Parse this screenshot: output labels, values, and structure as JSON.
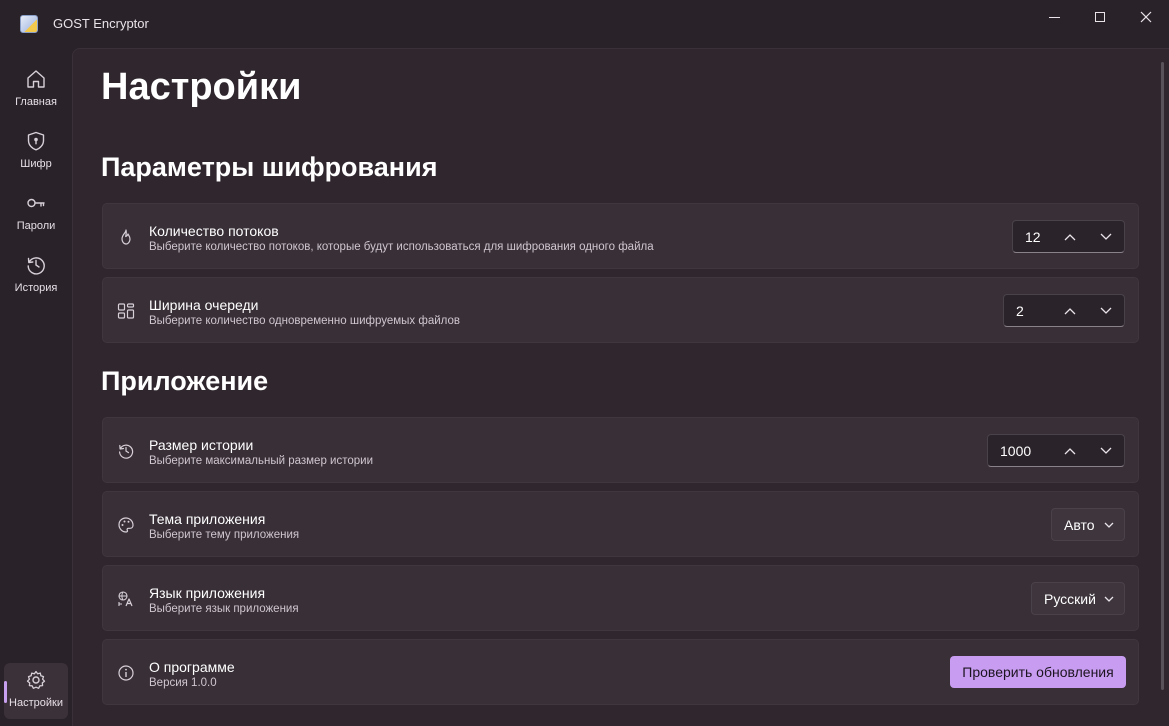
{
  "window": {
    "title": "GOST Encryptor",
    "controls": {
      "minimize": "minimize-icon",
      "maximize": "maximize-icon",
      "close": "close-icon"
    }
  },
  "nav": {
    "items": [
      {
        "label": "Главная",
        "icon": "home-icon"
      },
      {
        "label": "Шифр",
        "icon": "shield-icon"
      },
      {
        "label": "Пароли",
        "icon": "key-icon"
      },
      {
        "label": "История",
        "icon": "history-icon"
      }
    ],
    "settings": {
      "label": "Настройки",
      "icon": "gear-icon",
      "active": true
    }
  },
  "page": {
    "title": "Настройки"
  },
  "sections": {
    "encryption": {
      "title": "Параметры шифрования",
      "threads": {
        "title": "Количество потоков",
        "subtitle": "Выберите количество потоков, которые будут использоваться для шифрования одного файла",
        "value": "12",
        "icon": "flame-icon"
      },
      "queue": {
        "title": "Ширина очереди",
        "subtitle": "Выберите количество одновременно шифруемых файлов",
        "value": "2",
        "icon": "grid-icon"
      }
    },
    "app": {
      "title": "Приложение",
      "history": {
        "title": "Размер истории",
        "subtitle": "Выберите максимальный размер истории",
        "value": "1000",
        "icon": "history-icon"
      },
      "theme": {
        "title": "Тема приложения",
        "subtitle": "Выберите тему приложения",
        "value": "Авто",
        "icon": "palette-icon"
      },
      "language": {
        "title": "Язык приложения",
        "subtitle": "Выберите язык приложения",
        "value": "Русский",
        "icon": "translate-icon"
      },
      "about": {
        "title": "О программе",
        "subtitle": "Версия 1.0.0",
        "button": "Проверить обновления",
        "icon": "info-icon"
      }
    }
  },
  "colors": {
    "accent": "#c89cf0",
    "background": "#2a2229",
    "card": "#382f37"
  }
}
